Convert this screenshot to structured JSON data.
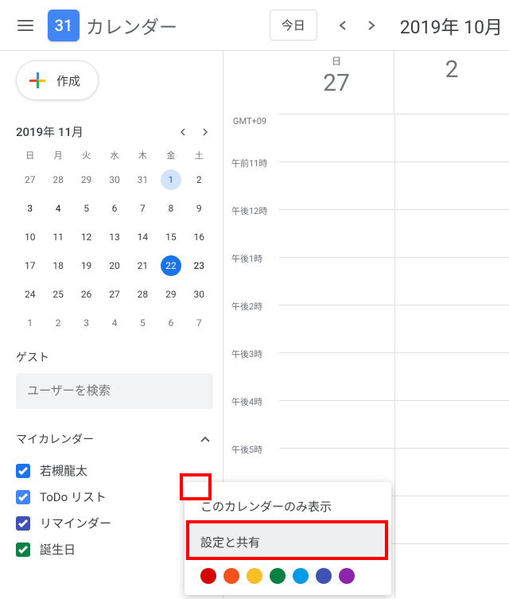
{
  "header": {
    "logo_day": "31",
    "title": "カレンダー",
    "today": "今日",
    "date": "2019年 10月"
  },
  "create": {
    "label": "作成"
  },
  "mini": {
    "title": "2019年 11月",
    "dows": [
      "日",
      "月",
      "火",
      "水",
      "木",
      "金",
      "土"
    ],
    "weeks": [
      [
        {
          "n": "27",
          "o": true
        },
        {
          "n": "28",
          "o": true
        },
        {
          "n": "29",
          "o": true
        },
        {
          "n": "30",
          "o": true
        },
        {
          "n": "31",
          "o": true
        },
        {
          "n": "1",
          "shade": true
        },
        {
          "n": "2"
        }
      ],
      [
        {
          "n": "3",
          "b": true
        },
        {
          "n": "4",
          "b": true
        },
        {
          "n": "5"
        },
        {
          "n": "6"
        },
        {
          "n": "7"
        },
        {
          "n": "8"
        },
        {
          "n": "9"
        }
      ],
      [
        {
          "n": "10"
        },
        {
          "n": "11"
        },
        {
          "n": "12"
        },
        {
          "n": "13"
        },
        {
          "n": "14"
        },
        {
          "n": "15"
        },
        {
          "n": "16"
        }
      ],
      [
        {
          "n": "17"
        },
        {
          "n": "18"
        },
        {
          "n": "19"
        },
        {
          "n": "20"
        },
        {
          "n": "21"
        },
        {
          "n": "22",
          "sel": true
        },
        {
          "n": "23",
          "b": true
        }
      ],
      [
        {
          "n": "24"
        },
        {
          "n": "25"
        },
        {
          "n": "26"
        },
        {
          "n": "27"
        },
        {
          "n": "28"
        },
        {
          "n": "29"
        },
        {
          "n": "30"
        }
      ],
      [
        {
          "n": "1",
          "o": true
        },
        {
          "n": "2",
          "o": true
        },
        {
          "n": "3",
          "o": true
        },
        {
          "n": "4",
          "o": true
        },
        {
          "n": "5",
          "o": true
        },
        {
          "n": "6",
          "o": true
        },
        {
          "n": "7",
          "o": true
        }
      ]
    ]
  },
  "guest": {
    "label": "ゲスト",
    "placeholder": "ユーザーを検索"
  },
  "mycal": {
    "label": "マイカレンダー",
    "items": [
      {
        "label": "若槻龍太",
        "color": "#1a73e8"
      },
      {
        "label": "ToDo リスト",
        "color": "#4285f4"
      },
      {
        "label": "リマインダー",
        "color": "#3f51b5"
      },
      {
        "label": "誕生日",
        "color": "#0b8043"
      }
    ]
  },
  "grid": {
    "tz": "GMT+09",
    "day_label": "日",
    "day_num_1": "27",
    "day_num_2": "2",
    "times": [
      "午前11時",
      "午後12時",
      "午後1時",
      "午後2時",
      "午後3時",
      "午後4時",
      "午後5時"
    ]
  },
  "ctx": {
    "only": "このカレンダーのみ表示",
    "settings": "設定と共有",
    "colors": [
      "#d50000",
      "#f4511e",
      "#f6bf26",
      "#0b8043",
      "#039be5",
      "#3f51b5",
      "#8e24aa"
    ]
  }
}
